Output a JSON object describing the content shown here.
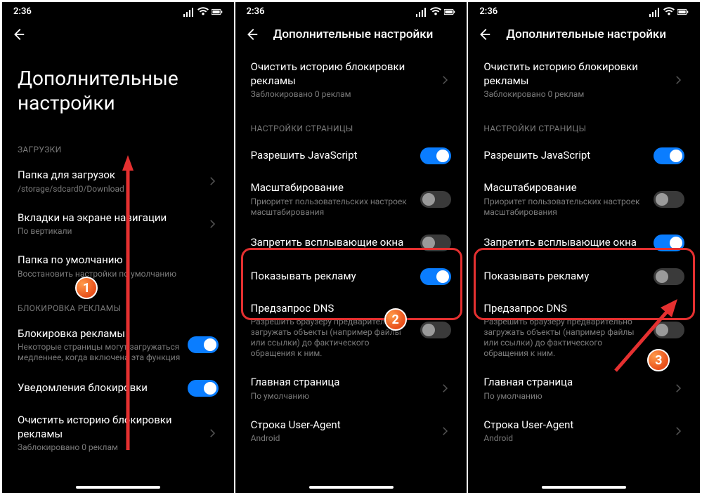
{
  "status": {
    "time": "2:36"
  },
  "screen1": {
    "title": "Дополнительные\nнастройки",
    "sections": {
      "downloads_header": "ЗАГРУЗКИ",
      "download_folder": {
        "label": "Папка для загрузок",
        "sub": "/storage/sdcard0/Download"
      },
      "nav_tabs": {
        "label": "Вкладки на экране навигации",
        "sub": "По вертикали"
      },
      "default_folder": {
        "label": "Папка по умолчанию",
        "sub": "Восстановить настройки по умолчанию"
      },
      "adblock_header": "БЛОКИРОВКА РЕКЛАМЫ",
      "adblock": {
        "label": "Блокировка рекламы",
        "sub": "Некоторые страницы могут загружаться медленнее, когда включена эта функция"
      },
      "block_notifications": {
        "label": "Уведомления блокировки"
      },
      "clear_history": {
        "label": "Очистить историю блокировки рекламы",
        "sub": "Заблокировано 0 реклам"
      }
    }
  },
  "screen2": {
    "header": "Дополнительные настройки",
    "clear_history": {
      "label": "Очистить историю блокировки рекламы",
      "sub": "Заблокировано 0 реклам"
    },
    "page_settings_header": "НАСТРОЙКИ СТРАНИЦЫ",
    "allow_js": {
      "label": "Разрешить JavaScript"
    },
    "zoom": {
      "label": "Масштабирование",
      "sub": "Приоритет пользовательских настроек масштабирования"
    },
    "block_popups": {
      "label": "Запретить всплывающие окна"
    },
    "show_ads": {
      "label": "Показывать рекламу"
    },
    "dns": {
      "label": "Предзапрос DNS",
      "sub": "Разрешить браузеру предварительно загружать объекты (например файлы или ссылки) до фактического обращения к ним."
    },
    "home": {
      "label": "Главная страница",
      "sub": "По умолчанию"
    },
    "ua": {
      "label": "Строка User-Agent",
      "sub": "Android"
    }
  },
  "screen3": {
    "header": "Дополнительные настройки",
    "clear_history": {
      "label": "Очистить историю блокировки рекламы",
      "sub": "Заблокировано 0 реклам"
    },
    "page_settings_header": "НАСТРОЙКИ СТРАНИЦЫ",
    "allow_js": {
      "label": "Разрешить JavaScript"
    },
    "zoom": {
      "label": "Масштабирование",
      "sub": "Приоритет пользовательских настроек масштабирования"
    },
    "block_popups": {
      "label": "Запретить всплывающие окна"
    },
    "show_ads": {
      "label": "Показывать рекламу"
    },
    "dns": {
      "label": "Предзапрос DNS",
      "sub": "Разрешить браузеру предварительно загружать объекты (например файлы или ссылки) до фактического обращения к ним."
    },
    "home": {
      "label": "Главная страница",
      "sub": "По умолчанию"
    },
    "ua": {
      "label": "Строка User-Agent",
      "sub": "Android"
    }
  },
  "steps": {
    "s1": "1",
    "s2": "2",
    "s3": "3"
  }
}
